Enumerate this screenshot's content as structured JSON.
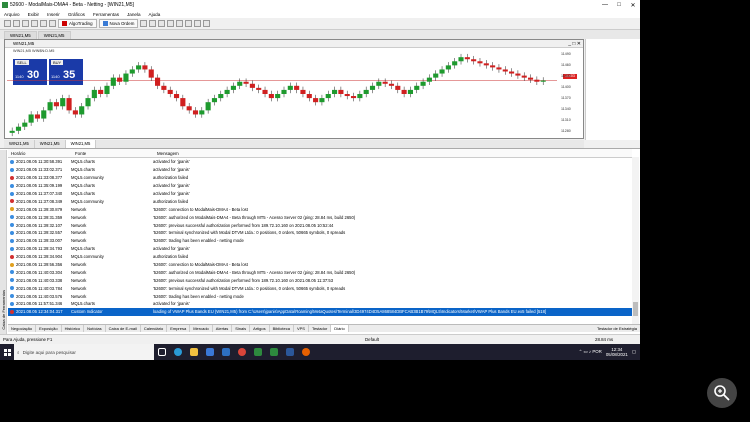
{
  "window": {
    "title": "52600 - ModalMais-DMA4 - Beta - Netting - [WIN21,M5]",
    "min": "—",
    "max": "□",
    "close": "✕"
  },
  "menu": [
    "Arquivo",
    "Exibir",
    "Inserir",
    "Gráficos",
    "Ferramentas",
    "Janela",
    "Ajuda"
  ],
  "toolbar": {
    "algo_label": "AlgoTrading",
    "new_order_label": "Nova Ordem"
  },
  "doc_tabs": [
    "WIN21,M5",
    "WIN21,M5"
  ],
  "chart": {
    "title": "WIN21,M5",
    "legend": "WIN21,M5  WIN$N:D.M5",
    "bid_panel": {
      "sell_label": "SELL",
      "buy_label": "BUY",
      "sell_lot": "1140",
      "sell_price": "30",
      "buy_lot": "1140",
      "buy_price": "35"
    },
    "current_price": "11403",
    "y_ticks": [
      "11490",
      "11460",
      "11430",
      "11400",
      "11370",
      "11340",
      "11310",
      "11280"
    ],
    "bottom_tabs": [
      "WIN21,M5",
      "WIN21,M5",
      "WIN21,M5"
    ]
  },
  "chart_data": {
    "type": "candlestick",
    "title": "WIN21,M5",
    "series": [
      {
        "name": "WIN21,M5",
        "values": [
          11280,
          11290,
          11300,
          11320,
          11310,
          11330,
          11350,
          11340,
          11360,
          11330,
          11320,
          11340,
          11360,
          11380,
          11370,
          11390,
          11410,
          11400,
          11420,
          11430,
          11440,
          11430,
          11410,
          11390,
          11380,
          11370,
          11360,
          11340,
          11330,
          11320,
          11330,
          11350,
          11360,
          11370,
          11380,
          11390,
          11400,
          11395,
          11385,
          11380,
          11370,
          11360,
          11370,
          11380,
          11390,
          11380,
          11370,
          11360,
          11350,
          11360,
          11370,
          11380,
          11370,
          11365,
          11360,
          11370,
          11380,
          11390,
          11400,
          11395,
          11390,
          11380,
          11370,
          11380,
          11390,
          11400,
          11410,
          11420,
          11430,
          11440,
          11450,
          11460,
          11455,
          11450,
          11445,
          11440,
          11435,
          11430,
          11425,
          11420,
          11415,
          11410,
          11405,
          11400,
          11403
        ]
      }
    ]
  },
  "navigator": {
    "title": ""
  },
  "toolbox": {
    "headers": {
      "time": "Horário",
      "source": "Fonte",
      "message": "Mensagem"
    },
    "rows": [
      {
        "time": "2021.08.05 11:30:58.391",
        "source": "MQL5.charts",
        "message": "activated for 'jpanis'",
        "status": "ok"
      },
      {
        "time": "2021.08.05 11:33:02.371",
        "source": "MQL5.charts",
        "message": "activated for 'jpanis'",
        "status": "ok"
      },
      {
        "time": "2021.08.05 11:33:08.377",
        "source": "MQL5.community",
        "message": "authorization failed",
        "status": "error"
      },
      {
        "time": "2021.08.05 11:35:09.199",
        "source": "MQL5.charts",
        "message": "activated for 'jpanis'",
        "status": "ok"
      },
      {
        "time": "2021.08.05 11:37:07.340",
        "source": "MQL5.charts",
        "message": "activated for 'jpanis'",
        "status": "ok"
      },
      {
        "time": "2021.08.05 11:37:08.349",
        "source": "MQL5.community",
        "message": "authorization failed",
        "status": "error"
      },
      {
        "time": "2021.08.05 11:39:30.879",
        "source": "Network",
        "message": "'52600': connection to ModalMais-DMA4 - Beta lost",
        "status": "warn"
      },
      {
        "time": "2021.08.05 11:39:31.359",
        "source": "Network",
        "message": "'52600': authorized on ModalMais-DMA4 - Beta through MT5 - Acesso Server 02 (ping: 28.84 ms, build 2650)",
        "status": "ok"
      },
      {
        "time": "2021.08.05 11:39:32.107",
        "source": "Network",
        "message": "'52600': previous successful authorization performed from 189.72.10.160 on 2021.08.05 10:52:44",
        "status": "ok"
      },
      {
        "time": "2021.08.05 11:39:32.557",
        "source": "Network",
        "message": "'52600': terminal synchronized with Modal DTVM Ltda.: 0 positions, 0 orders, 50665 symbols, 0 spreads",
        "status": "ok"
      },
      {
        "time": "2021.08.05 11:39:33.007",
        "source": "Network",
        "message": "'52600': trading has been enabled - netting mode",
        "status": "ok"
      },
      {
        "time": "2021.08.05 11:39:34.793",
        "source": "MQL5.charts",
        "message": "activated for 'jpanis'",
        "status": "ok"
      },
      {
        "time": "2021.08.05 11:39:34.904",
        "source": "MQL5.community",
        "message": "authorization failed",
        "status": "error"
      },
      {
        "time": "2021.08.05 11:39:56.356",
        "source": "Network",
        "message": "'52600': connection to ModalMais-DMA4 - Beta lost",
        "status": "warn"
      },
      {
        "time": "2021.08.05 11:40:03.304",
        "source": "Network",
        "message": "'52600': authorized on ModalMais-DMA4 - Beta through MT5 - Acesso Server 02 (ping: 28.84 ms, build 2650)",
        "status": "ok"
      },
      {
        "time": "2021.08.05 11:40:03.338",
        "source": "Network",
        "message": "'52600': previous successful authorization performed from 189.72.10.160 on 2021.08.05 11:37:53",
        "status": "ok"
      },
      {
        "time": "2021.08.05 11:40:03.784",
        "source": "Network",
        "message": "'52600': terminal synchronized with Modal DTVM Ltda.: 0 positions, 0 orders, 50665 symbols, 0 spreads",
        "status": "ok"
      },
      {
        "time": "2021.08.05 11:40:03.576",
        "source": "Network",
        "message": "'52600': trading has been enabled - netting mode",
        "status": "ok"
      },
      {
        "time": "2021.08.05 11:57:51.346",
        "source": "MQL5.charts",
        "message": "activated for 'jpanis'",
        "status": "ok"
      },
      {
        "time": "2021.08.05 12:34:04.317",
        "source": "Custom Indicator",
        "message": "loading of VWAP Plus Bands EU (WIN21,M5) from C:\\Users\\jpanis\\AppData\\Roaming\\MetaQuotes\\Terminal\\3D4974D4D5A868584DBFCAB3B1B79\\MQL5\\Indicators\\Market\\VWAP Plus Bands EU.ex5 failed [518]",
        "status": "error",
        "selected": true
      }
    ],
    "tabs": [
      "Negociação",
      "Exposição",
      "Histórico",
      "Notícias",
      "Caixa de E-mail",
      "Calendário",
      "Empresa",
      "Mercado",
      "Alertas",
      "Sinais",
      "Artigos",
      "Biblioteca",
      "VPS",
      "Testador",
      "Diário"
    ],
    "selected_tab": "Diário",
    "tester_label": "Testador de Estratégia",
    "side_label": "Caixa de Ferramentas"
  },
  "status": {
    "help": "Para Ajuda, pressione F1",
    "profile": "Default",
    "connection": "28.84 ms"
  },
  "taskbar": {
    "search_placeholder": "Digite aqui para pesquisar",
    "time": "12:34",
    "date": "05/08/2021"
  }
}
